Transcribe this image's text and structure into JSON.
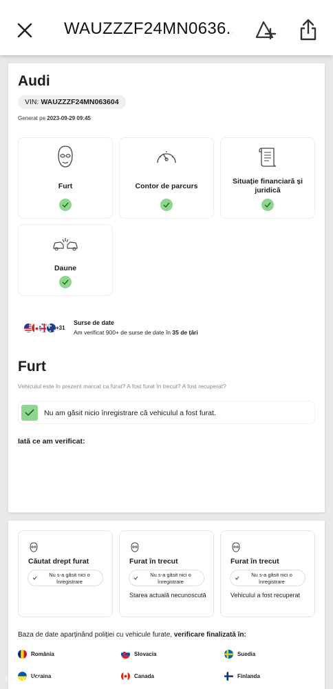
{
  "header": {
    "title": "WAUZZZF24MN0636...",
    "icons": [
      "close-icon",
      "add-alert-icon",
      "share-icon"
    ]
  },
  "vehicle": {
    "brand": "Audi",
    "vin_label": "VIN:",
    "vin": "WAUZZZF24MN063604",
    "generated_label": "Generat pe",
    "generated_at": "2023-09-29 09:45"
  },
  "summary_tiles": [
    {
      "label": "Furt",
      "icon": "thief-mask-icon",
      "status": "ok"
    },
    {
      "label": "Contor de parcurs",
      "icon": "odometer-icon",
      "status": "ok"
    },
    {
      "label": "Situație financiară și juridică",
      "icon": "document-scroll-icon",
      "status": "ok"
    },
    {
      "label": "Daune",
      "icon": "car-crash-icon",
      "status": "ok"
    }
  ],
  "sources": {
    "more_count": "+31",
    "title": "Surse de date",
    "text_prefix": "Am verificat 900+ de surse de date în ",
    "countries_count": "35 de țări"
  },
  "theft_section": {
    "title": "Furt",
    "question": "Vehiculul este în prezent marcat ca furat? A fost furat în trecut? A fost recuperat?",
    "result": "Nu am găsit nicio înregistrare că vehiculul a fost furat.",
    "checked_title": "Iată ce am verificat:"
  },
  "checks": [
    {
      "title": "Căutat drept furat",
      "pill": "Nu s-a găsit nici o înregistrare",
      "note": ""
    },
    {
      "title": "Furat în trecut",
      "pill": "Nu s-a găsit nici o înregistrare",
      "note": "Starea actuală necunoscută"
    },
    {
      "title": "Furat în trecut",
      "pill": "Nu s-a găsit nici o înregistrare",
      "note": "Vehiculul a fost recuperat"
    }
  ],
  "databases": {
    "prefix": "Baza de date aparținând poliției cu vehicule furate, ",
    "bold": "verificare finalizată în:",
    "countries": [
      "România",
      "Slovacia",
      "Suedia",
      "Ucraina",
      "Canada",
      "Finlanda"
    ]
  },
  "watermark": "autovit.ro",
  "colors": {
    "check_green": "#8fd48f",
    "background": "#e9e9ea"
  }
}
